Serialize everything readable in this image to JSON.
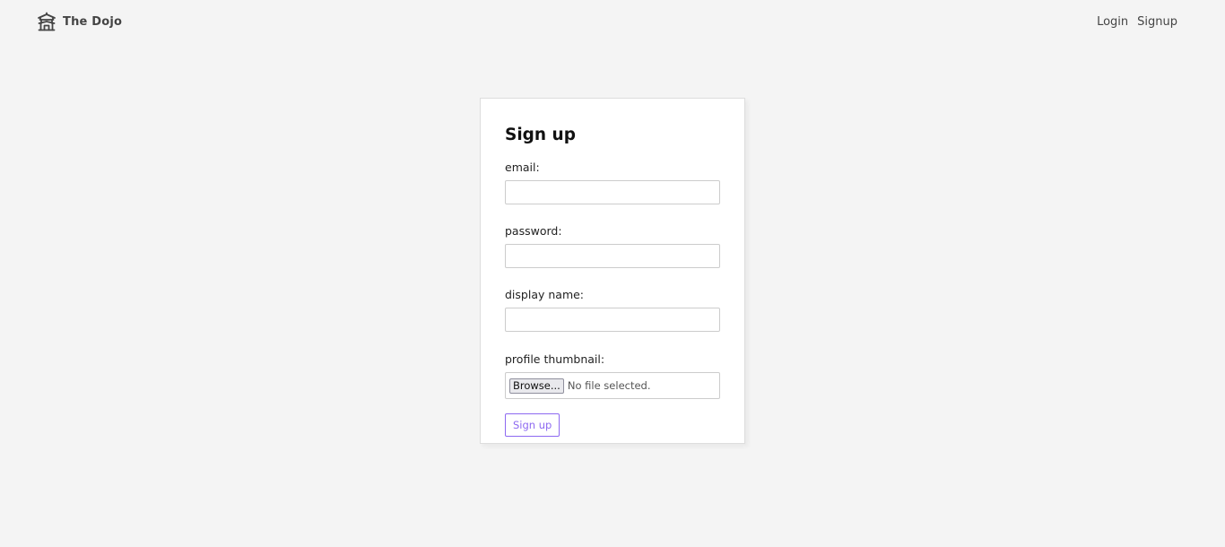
{
  "navbar": {
    "brand_name": "The Dojo",
    "links": [
      {
        "label": "Login"
      },
      {
        "label": "Signup"
      }
    ]
  },
  "form": {
    "title": "Sign up",
    "fields": {
      "email": {
        "label": "email:",
        "value": ""
      },
      "password": {
        "label": "password:",
        "value": ""
      },
      "display_name": {
        "label": "display name:",
        "value": ""
      },
      "thumbnail": {
        "label": "profile thumbnail:",
        "browse_label": "Browse...",
        "status": "No file selected."
      }
    },
    "submit_label": "Sign up"
  },
  "colors": {
    "accent": "#8d69f1",
    "background": "#f4f4f4"
  },
  "icons": {
    "brand": "temple-icon"
  }
}
